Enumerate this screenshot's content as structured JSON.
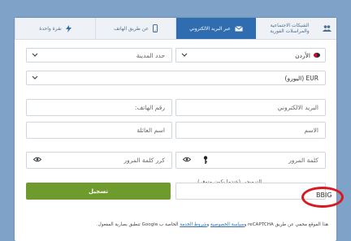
{
  "tabs": [
    {
      "label": "نقرة واحدة",
      "icon": "lightning-icon",
      "active": false
    },
    {
      "label": "عن طريق الهاتف",
      "icon": "phone-icon",
      "active": false
    },
    {
      "label": "عبر البريد الالكتروني",
      "icon": "envelope-icon",
      "active": true
    },
    {
      "label": "الشبكات الاجتماعية والمراسلات الفورية",
      "icon": "users-icon",
      "active": false
    }
  ],
  "form": {
    "country": "الأردن",
    "city_placeholder": "حدد المدينة",
    "currency": "EUR (اليورو)",
    "email_placeholder": "البريد الالكتروني",
    "phone_placeholder": "رقم الهاتف:",
    "first_name_placeholder": "الاسم",
    "last_name_placeholder": "اسم العائلة",
    "password_placeholder": "كلمة المرور",
    "confirm_password_placeholder": "كرر كلمة المرور",
    "promo_label": "التزويجي (عندما يكون متوفر)",
    "promo_value": "BBIG",
    "register_button": "تسجيل"
  },
  "legal": {
    "prefix": "هذا الموقع محمي عن طريق reCAPTCHA و",
    "privacy_link": "سياسة الخصوصية",
    "middle": " و",
    "terms_link": "شروط الخدمة",
    "suffix": " الخاصة ب Google تنطبق بصارية المفعول."
  },
  "colors": {
    "background": "#7fa3c8",
    "active_tab": "#2f6db0",
    "button": "#6f9a2e",
    "highlight_circle": "#d9191f"
  }
}
